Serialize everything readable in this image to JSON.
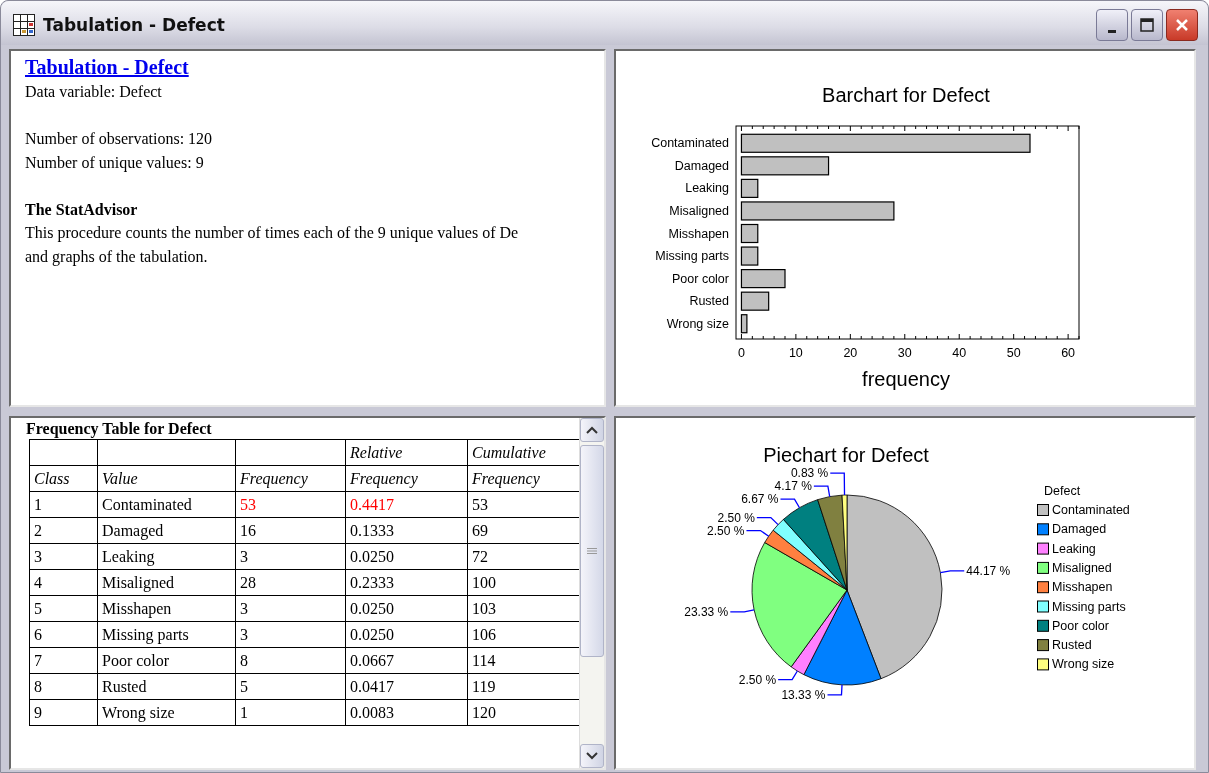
{
  "window": {
    "title": "Tabulation - Defect"
  },
  "summary": {
    "heading": "Tabulation - Defect",
    "data_variable": "Data variable: Defect",
    "stats": [
      "Number of observations: 120",
      "Number of unique values: 9"
    ],
    "advisor_title": "The StatAdvisor",
    "advisor_lines": [
      "This procedure counts the number of times each of the 9 unique values of De",
      "and graphs of the tabulation."
    ]
  },
  "barchart": {
    "chart_data": {
      "type": "bar",
      "orientation": "horizontal",
      "title": "Barchart for Defect",
      "xlabel": "frequency",
      "categories": [
        "Contaminated",
        "Damaged",
        "Leaking",
        "Misaligned",
        "Misshapen",
        "Missing parts",
        "Poor color",
        "Rusted",
        "Wrong size"
      ],
      "values": [
        53,
        16,
        3,
        28,
        3,
        3,
        8,
        5,
        1
      ],
      "xlim": [
        -1,
        62
      ],
      "xticks": [
        0,
        10,
        20,
        30,
        40,
        50,
        60
      ]
    }
  },
  "table": {
    "title": "Frequency Table for Defect",
    "columns": [
      {
        "label": "Class"
      },
      {
        "label": "Value"
      },
      {
        "label": "Frequency"
      },
      {
        "top": "Relative",
        "label": "Frequency"
      },
      {
        "top": "Cumulative",
        "label": "Frequency"
      }
    ],
    "rows": [
      {
        "cells": [
          "1",
          "Contaminated",
          "53",
          "0.4417",
          "53"
        ],
        "highlighted": true
      },
      {
        "cells": [
          "2",
          "Damaged",
          "16",
          "0.1333",
          "69"
        ],
        "highlighted": false
      },
      {
        "cells": [
          "3",
          "Leaking",
          "3",
          "0.0250",
          "72"
        ],
        "highlighted": false
      },
      {
        "cells": [
          "4",
          "Misaligned",
          "28",
          "0.2333",
          "100"
        ],
        "highlighted": false
      },
      {
        "cells": [
          "5",
          "Misshapen",
          "3",
          "0.0250",
          "103"
        ],
        "highlighted": false
      },
      {
        "cells": [
          "6",
          "Missing parts",
          "3",
          "0.0250",
          "106"
        ],
        "highlighted": false
      },
      {
        "cells": [
          "7",
          "Poor color",
          "8",
          "0.0667",
          "114"
        ],
        "highlighted": false
      },
      {
        "cells": [
          "8",
          "Rusted",
          "5",
          "0.0417",
          "119"
        ],
        "highlighted": false
      },
      {
        "cells": [
          "9",
          "Wrong size",
          "1",
          "0.0083",
          "120"
        ],
        "highlighted": false
      }
    ]
  },
  "piechart": {
    "chart_data": {
      "type": "pie",
      "title": "Piechart for Defect",
      "categories": [
        "Contaminated",
        "Damaged",
        "Leaking",
        "Misaligned",
        "Misshapen",
        "Missing parts",
        "Poor color",
        "Rusted",
        "Wrong size"
      ],
      "values": [
        44.17,
        13.33,
        2.5,
        23.33,
        2.5,
        2.5,
        6.67,
        4.17,
        0.83
      ],
      "value_labels": [
        "44.17 %",
        "13.33 %",
        "2.50 %",
        "23.33 %",
        "2.50 %",
        "2.50 %",
        "6.67 %",
        "4.17 %",
        "0.83 %"
      ],
      "legend": {
        "title": "Defect",
        "items": [
          {
            "color": "#c0c0c0"
          },
          {
            "color": "#0080ff"
          },
          {
            "color": "#ff80ff"
          },
          {
            "color": "#80ff80"
          },
          {
            "color": "#ff8040"
          },
          {
            "color": "#80ffff"
          },
          {
            "color": "#008080"
          },
          {
            "color": "#808040"
          },
          {
            "color": "#ffff80"
          }
        ]
      }
    }
  }
}
